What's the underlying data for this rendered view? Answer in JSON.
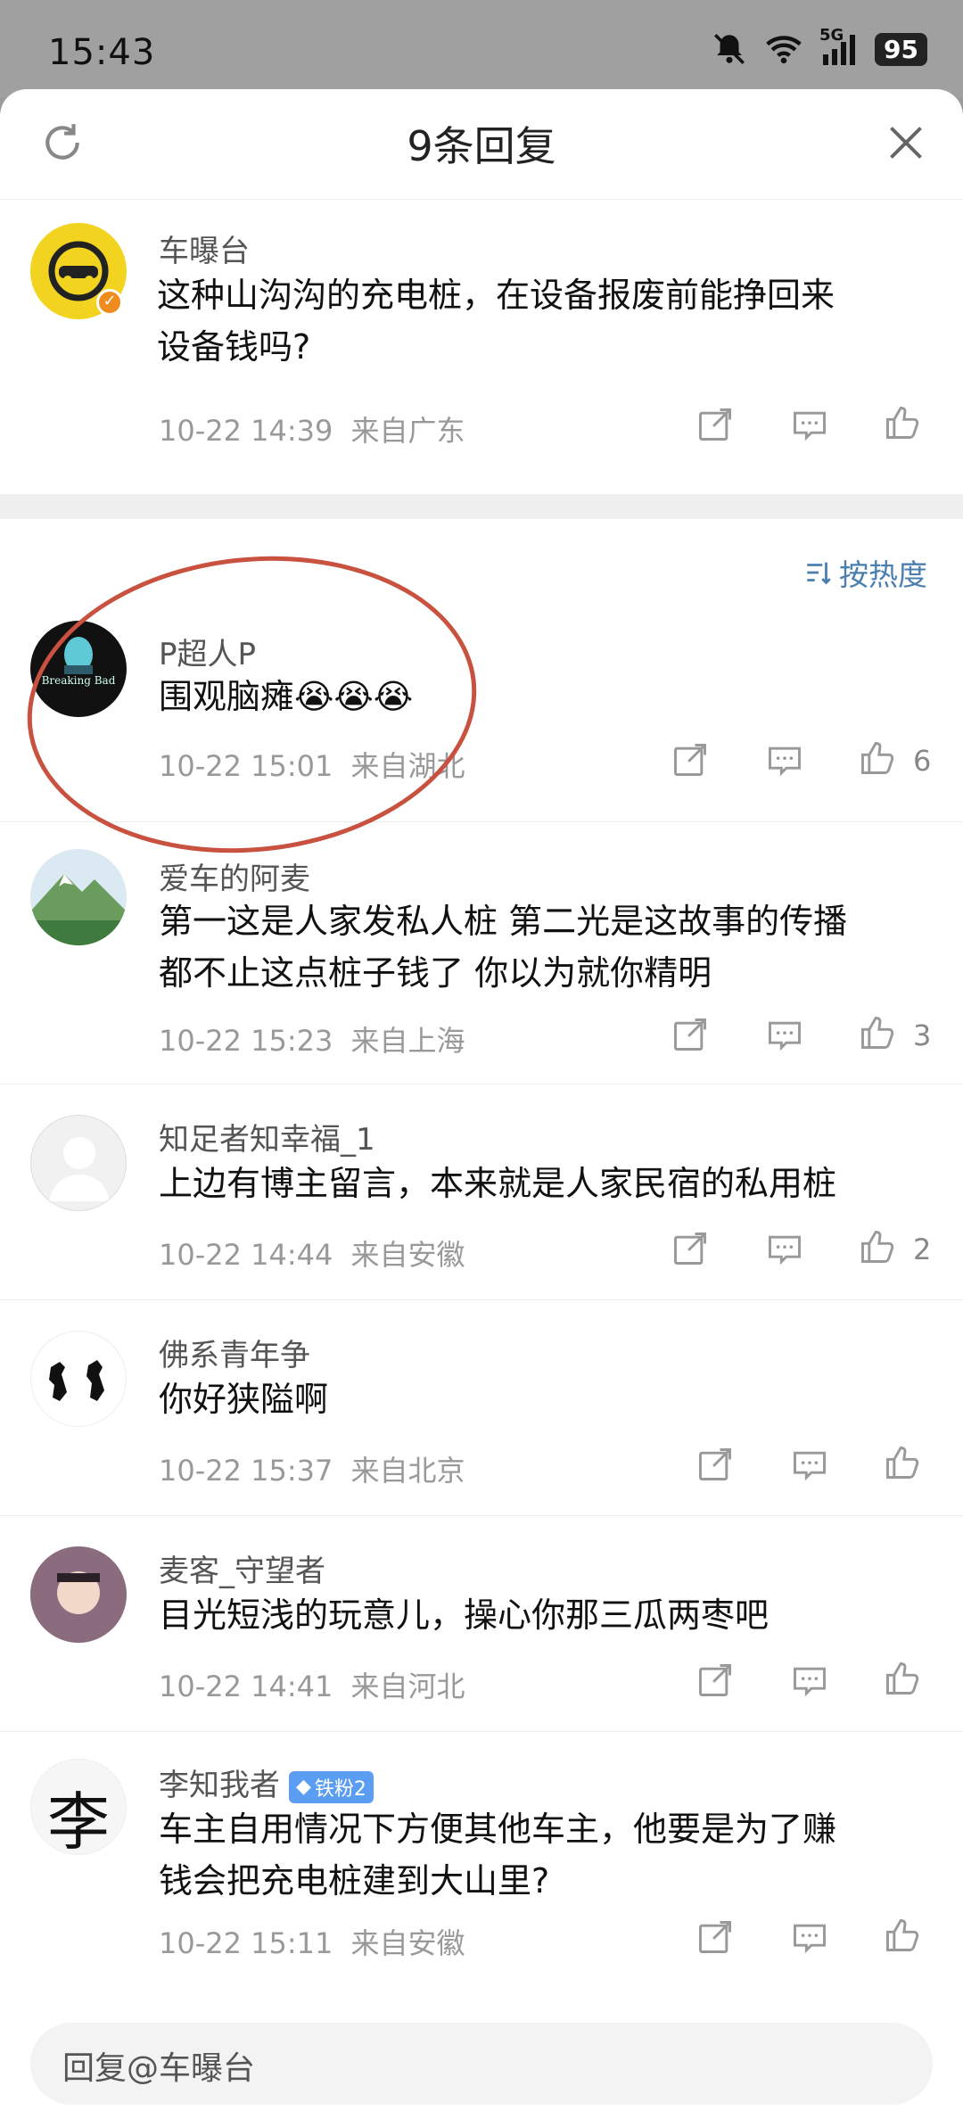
{
  "status": {
    "time": "15:43",
    "network": "5G",
    "battery": "95"
  },
  "header": {
    "title": "9条回复"
  },
  "main_comment": {
    "username": "车曝台",
    "text_line1": "这种山沟沟的充电桩，在设备报废前能挣回来",
    "text_line2": "设备钱吗?",
    "time": "10-22 14:39",
    "location": "来自广东"
  },
  "sort": {
    "label": "按热度"
  },
  "replies": [
    {
      "username": "P超人P",
      "text": "围观脑瘫😭😭😭",
      "time": "10-22 15:01",
      "location": "来自湖北",
      "likes": "6",
      "avatar_text": "Breaking Bad"
    },
    {
      "username": "爱车的阿麦",
      "text_line1": "第一这是人家发私人桩 第二光是这故事的传播",
      "text_line2": "都不止这点桩子钱了 你以为就你精明",
      "time": "10-22 15:23",
      "location": "来自上海",
      "likes": "3"
    },
    {
      "username": "知足者知幸福_1",
      "text": "上边有博主留言，本来就是人家民宿的私用桩",
      "time": "10-22 14:44",
      "location": "来自安徽",
      "likes": "2"
    },
    {
      "username": "佛系青年争",
      "text": "你好狭隘啊",
      "time": "10-22 15:37",
      "location": "来自北京",
      "likes": ""
    },
    {
      "username": "麦客_守望者",
      "text": "目光短浅的玩意儿，操心你那三瓜两枣吧",
      "time": "10-22 14:41",
      "location": "来自河北",
      "likes": ""
    },
    {
      "username": "李知我者",
      "badge": "铁粉2",
      "avatar_text": "李",
      "text_line1": "车主自用情况下方便其他车主，他要是为了赚",
      "text_line2": "钱会把充电桩建到大山里?",
      "time": "10-22 15:11",
      "location": "来自安徽",
      "likes": ""
    }
  ],
  "input": {
    "placeholder": "回复@车曝台"
  },
  "colors": {
    "accent": "#4a7fb0",
    "annotation": "#c8513f",
    "badge": "#5b9df2"
  }
}
